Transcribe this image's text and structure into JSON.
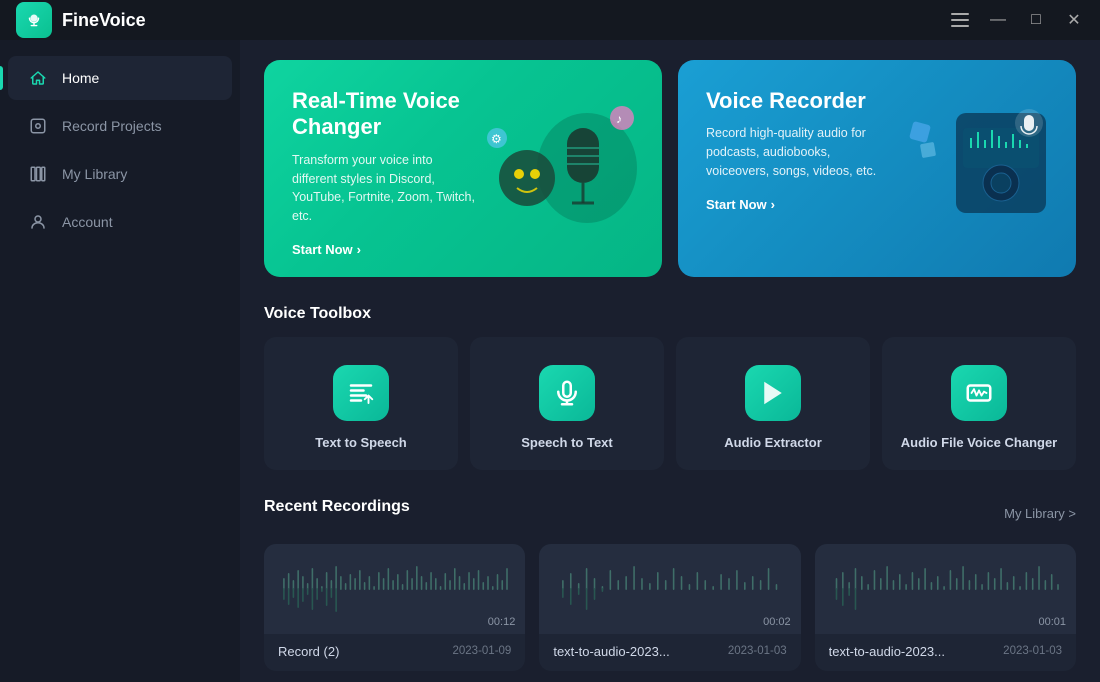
{
  "app": {
    "name": "FineVoice"
  },
  "titlebar": {
    "controls": {
      "menu": "☰",
      "minimize": "—",
      "maximize": "□",
      "close": "✕"
    }
  },
  "sidebar": {
    "items": [
      {
        "id": "home",
        "label": "Home",
        "active": true
      },
      {
        "id": "record-projects",
        "label": "Record Projects",
        "active": false
      },
      {
        "id": "my-library",
        "label": "My Library",
        "active": false
      },
      {
        "id": "account",
        "label": "Account",
        "active": false
      }
    ]
  },
  "hero": {
    "cards": [
      {
        "id": "realtime-voice-changer",
        "title": "Real-Time Voice Changer",
        "description": "Transform your voice into different styles in Discord, YouTube, Fortnite, Zoom, Twitch, etc.",
        "link": "Start Now"
      },
      {
        "id": "voice-recorder",
        "title": "Voice Recorder",
        "description": "Record high-quality audio for podcasts, audiobooks, voiceovers, songs, videos, etc.",
        "link": "Start Now"
      }
    ]
  },
  "toolbox": {
    "section_title": "Voice Toolbox",
    "items": [
      {
        "id": "text-to-speech",
        "label": "Text to Speech"
      },
      {
        "id": "speech-to-text",
        "label": "Speech to Text"
      },
      {
        "id": "audio-extractor",
        "label": "Audio Extractor"
      },
      {
        "id": "audio-file-voice-changer",
        "label": "Audio File Voice Changer"
      }
    ]
  },
  "recent_recordings": {
    "section_title": "Recent Recordings",
    "library_link": "My Library >",
    "items": [
      {
        "id": "record-2",
        "name": "Record (2)",
        "date": "2023-01-09",
        "duration": "00:12"
      },
      {
        "id": "text-to-audio-1",
        "name": "text-to-audio-2023...",
        "date": "2023-01-03",
        "duration": "00:02"
      },
      {
        "id": "text-to-audio-2",
        "name": "text-to-audio-2023...",
        "date": "2023-01-03",
        "duration": "00:01"
      }
    ]
  },
  "colors": {
    "accent": "#1ad8b0",
    "sidebar_bg": "#161b27",
    "card_bg": "#1e2535",
    "main_bg": "#1a1f2e"
  }
}
